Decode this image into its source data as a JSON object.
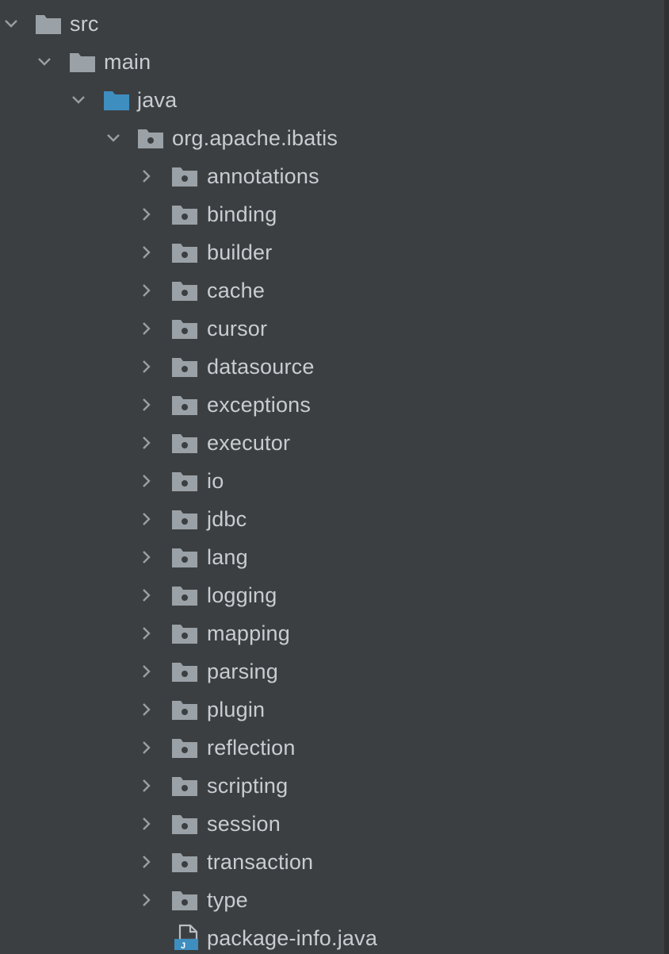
{
  "tree": {
    "src": {
      "label": "src",
      "expanded": true,
      "icon": "folder-icon"
    },
    "main": {
      "label": "main",
      "expanded": true,
      "icon": "folder-icon"
    },
    "java": {
      "label": "java",
      "expanded": true,
      "icon": "source-root-folder-icon",
      "icon_color": "#3e8ec0"
    },
    "package_root": {
      "label": "org.apache.ibatis",
      "expanded": true,
      "icon": "package-icon"
    },
    "packages": [
      {
        "label": "annotations",
        "expanded": false,
        "icon": "package-icon"
      },
      {
        "label": "binding",
        "expanded": false,
        "icon": "package-icon"
      },
      {
        "label": "builder",
        "expanded": false,
        "icon": "package-icon"
      },
      {
        "label": "cache",
        "expanded": false,
        "icon": "package-icon"
      },
      {
        "label": "cursor",
        "expanded": false,
        "icon": "package-icon"
      },
      {
        "label": "datasource",
        "expanded": false,
        "icon": "package-icon"
      },
      {
        "label": "exceptions",
        "expanded": false,
        "icon": "package-icon"
      },
      {
        "label": "executor",
        "expanded": false,
        "icon": "package-icon"
      },
      {
        "label": "io",
        "expanded": false,
        "icon": "package-icon"
      },
      {
        "label": "jdbc",
        "expanded": false,
        "icon": "package-icon"
      },
      {
        "label": "lang",
        "expanded": false,
        "icon": "package-icon"
      },
      {
        "label": "logging",
        "expanded": false,
        "icon": "package-icon"
      },
      {
        "label": "mapping",
        "expanded": false,
        "icon": "package-icon"
      },
      {
        "label": "parsing",
        "expanded": false,
        "icon": "package-icon"
      },
      {
        "label": "plugin",
        "expanded": false,
        "icon": "package-icon"
      },
      {
        "label": "reflection",
        "expanded": false,
        "icon": "package-icon"
      },
      {
        "label": "scripting",
        "expanded": false,
        "icon": "package-icon"
      },
      {
        "label": "session",
        "expanded": false,
        "icon": "package-icon"
      },
      {
        "label": "transaction",
        "expanded": false,
        "icon": "package-icon"
      },
      {
        "label": "type",
        "expanded": false,
        "icon": "package-icon"
      }
    ],
    "file": {
      "label": "package-info.java",
      "icon": "java-file-icon"
    }
  },
  "colors": {
    "background": "#3c3f41",
    "text": "#c9ccd0",
    "folder": "#9aa1a7",
    "source_folder": "#3e8ec0",
    "arrow": "#9a9ea3"
  }
}
